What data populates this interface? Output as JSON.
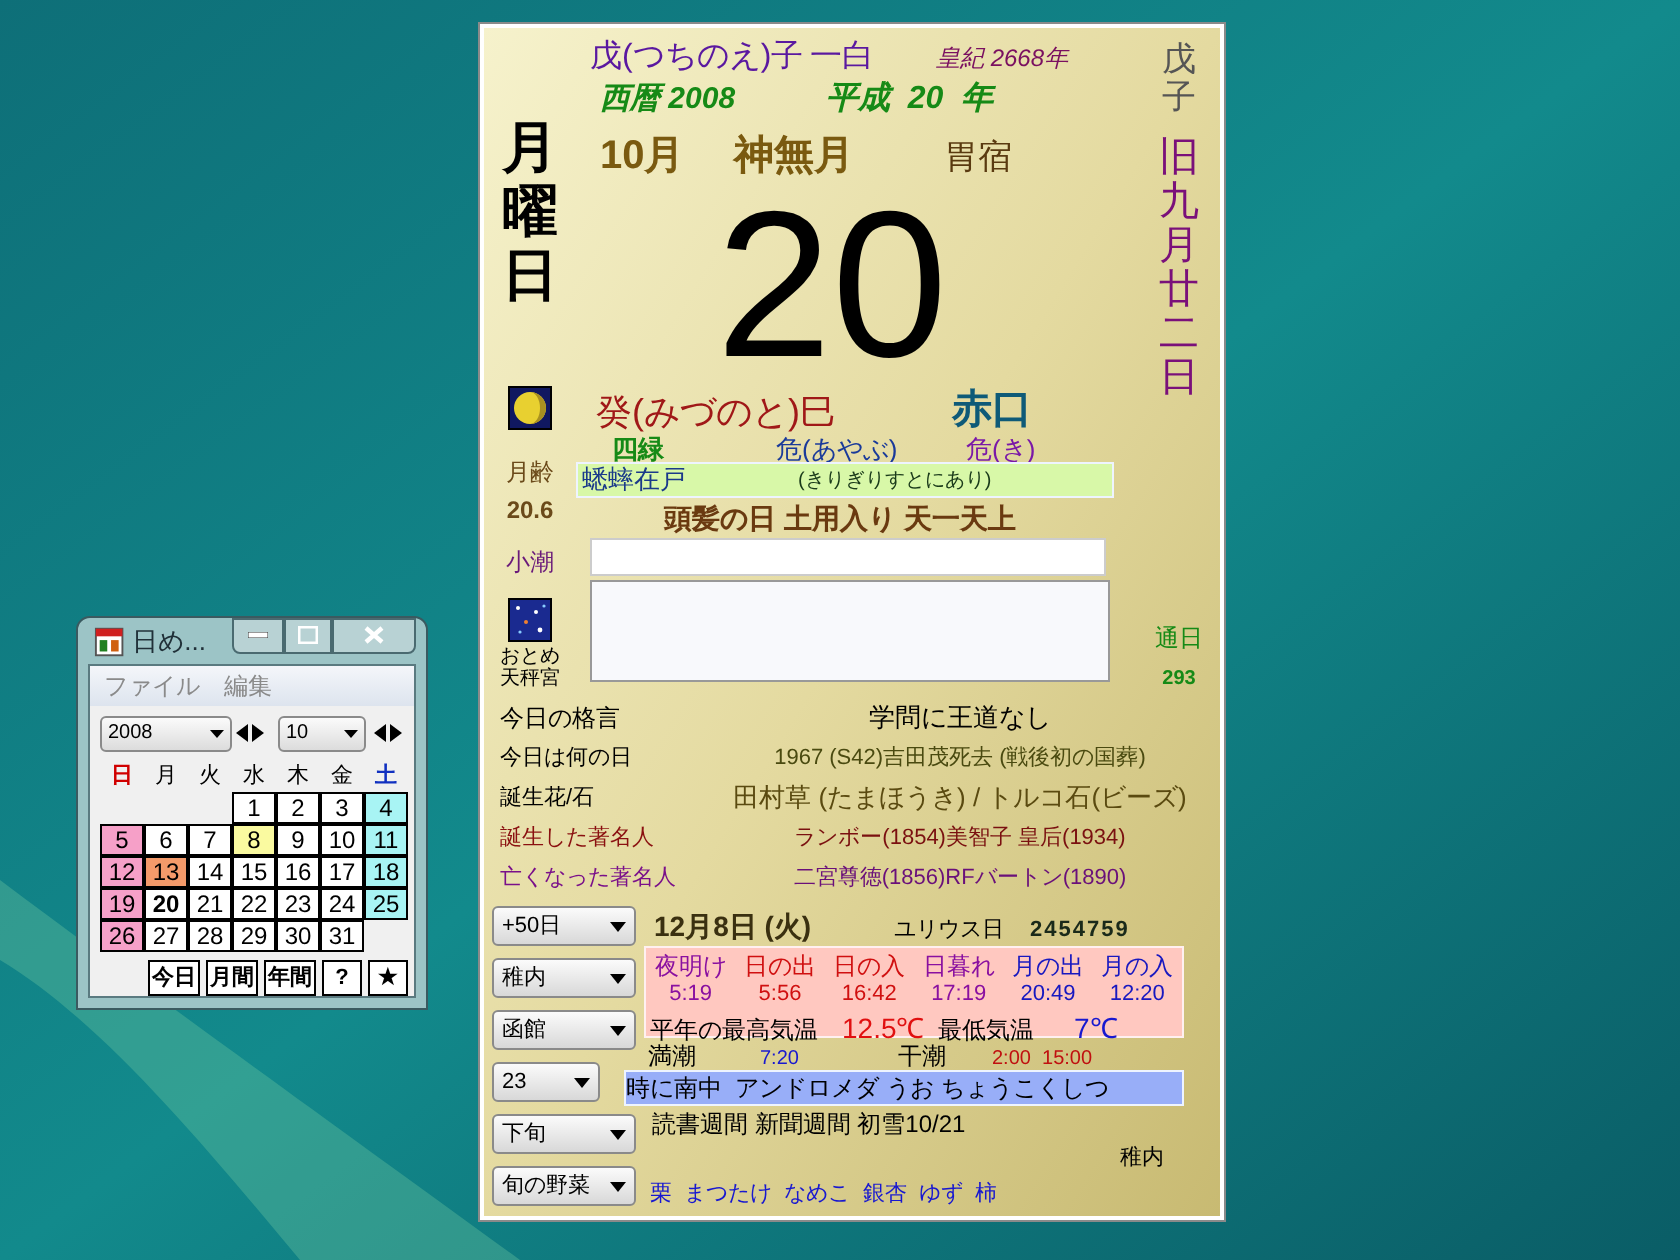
{
  "main_calendar": {
    "year_eto": "戊(つちのえ)子",
    "year_star": "一白",
    "imperial_year": "皇紀 2668年",
    "western_year": "西暦 2008",
    "era_year": "平成  20  年",
    "month": "10月",
    "month_name": "神無月",
    "lunar_mansion": "胃宿",
    "weekday": "月曜日",
    "day": "20",
    "side_eto": "戊子",
    "lunar_date": "旧九月廿二日",
    "moon_age_label": "月齢",
    "moon_age": "20.6",
    "tide": "小潮",
    "zodiac": "おとめ",
    "zodiac_palace": "天秤宮",
    "day_eto": "癸(みづのと)巳",
    "rokuyo": "赤口",
    "day_star": "四緑",
    "choku": "危(あやぶ)",
    "shuku": "危(き)",
    "seasonal_term": "蟋蟀在戸",
    "seasonal_term_reading": "(きりぎりすとにあり)",
    "events": "頭髪の日 土用入り 天一天上",
    "day_count_label": "通日",
    "day_count": "293",
    "info_rows": [
      {
        "kind": "motto",
        "label": "今日の格言",
        "value": "学問に王道なし"
      },
      {
        "kind": "history",
        "label": "今日は何の日",
        "value": "1967 (S42)吉田茂死去 (戦後初の国葬)"
      },
      {
        "kind": "flower",
        "label": "誕生花/石",
        "value": "田村草 (たまほうき) / トルコ石(ビーズ)"
      },
      {
        "kind": "born",
        "label": "誕生した著名人",
        "value": "ランボー(1854)美智子 皇后(1934)"
      },
      {
        "kind": "died",
        "label": "亡くなった著名人",
        "value": "二宮尊徳(1856)RFバートン(1890)"
      }
    ]
  },
  "lower": {
    "selectors": [
      {
        "value": "+50日"
      },
      {
        "value": "稚内"
      },
      {
        "value": "函館"
      },
      {
        "value": "23"
      },
      {
        "value": "下旬"
      },
      {
        "value": "旬の野菜"
      }
    ],
    "future_date": "12月8日 (火)",
    "julian_label": "ユリウス日",
    "julian_day": "2454759",
    "sun_moon": [
      {
        "kind": "twilight",
        "label": "夜明け",
        "time": "5:19"
      },
      {
        "kind": "sun",
        "label": "日の出",
        "time": "5:56"
      },
      {
        "kind": "sun",
        "label": "日の入",
        "time": "16:42"
      },
      {
        "kind": "twilight",
        "label": "日暮れ",
        "time": "17:19"
      },
      {
        "kind": "moon",
        "label": "月の出",
        "time": "20:49"
      },
      {
        "kind": "moon",
        "label": "月の入",
        "time": "12:20"
      }
    ],
    "temp_high_label": "平年の最高気温",
    "temp_high": "12.5℃",
    "temp_low_label": "最低気温",
    "temp_low": "7℃",
    "high_tide_label": "満潮",
    "high_tide": "7:20",
    "low_tide_label": "干潮",
    "low_tide": "2:00  15:00",
    "transit": "時に南中  アンドロメダ うお ちょうこくしつ",
    "notes": "読書週間 新聞週間 初雪10/21",
    "location": "稚内",
    "seasonal_foods": "栗  まつたけ  なめこ  銀杏  ゆず  柿"
  },
  "mini_window": {
    "title": "日め...",
    "menu": [
      "ファイル",
      "編集"
    ],
    "year": "2008",
    "month": "10",
    "weekdays": [
      {
        "label": "日",
        "kind": "sunday"
      },
      {
        "label": "月",
        "kind": "weekday"
      },
      {
        "label": "火",
        "kind": "weekday"
      },
      {
        "label": "水",
        "kind": "weekday"
      },
      {
        "label": "木",
        "kind": "weekday"
      },
      {
        "label": "金",
        "kind": "weekday"
      },
      {
        "label": "土",
        "kind": "saturday"
      }
    ],
    "weeks": [
      [
        {
          "kind": "blank"
        },
        {
          "kind": "blank"
        },
        {
          "kind": "blank"
        },
        {
          "label": "1",
          "color": "#ffffff",
          "selected": false
        },
        {
          "label": "2",
          "color": "#ffffff",
          "selected": false
        },
        {
          "label": "3",
          "color": "#ffffff",
          "selected": false
        },
        {
          "label": "4",
          "color": "#a8f4f4",
          "selected": false
        }
      ],
      [
        {
          "label": "5",
          "color": "#f6a0c8",
          "selected": false
        },
        {
          "label": "6",
          "color": "#ffffff",
          "selected": false
        },
        {
          "label": "7",
          "color": "#ffffff",
          "selected": false
        },
        {
          "label": "8",
          "color": "#fafaa0",
          "selected": false
        },
        {
          "label": "9",
          "color": "#ffffff",
          "selected": false
        },
        {
          "label": "10",
          "color": "#ffffff",
          "selected": false
        },
        {
          "label": "11",
          "color": "#a8f4f4",
          "selected": false
        }
      ],
      [
        {
          "label": "12",
          "color": "#f6a0c8",
          "selected": false
        },
        {
          "label": "13",
          "color": "#f49a6a",
          "selected": false
        },
        {
          "label": "14",
          "color": "#ffffff",
          "selected": false
        },
        {
          "label": "15",
          "color": "#ffffff",
          "selected": false
        },
        {
          "label": "16",
          "color": "#ffffff",
          "selected": false
        },
        {
          "label": "17",
          "color": "#ffffff",
          "selected": false
        },
        {
          "label": "18",
          "color": "#a8f4f4",
          "selected": false
        }
      ],
      [
        {
          "label": "19",
          "color": "#f6a0c8",
          "selected": false
        },
        {
          "label": "20",
          "color": "#ffffff",
          "selected": true
        },
        {
          "label": "21",
          "color": "#ffffff",
          "selected": false
        },
        {
          "label": "22",
          "color": "#ffffff",
          "selected": false
        },
        {
          "label": "23",
          "color": "#ffffff",
          "selected": false
        },
        {
          "label": "24",
          "color": "#ffffff",
          "selected": false
        },
        {
          "label": "25",
          "color": "#a8f4f4",
          "selected": false
        }
      ],
      [
        {
          "label": "26",
          "color": "#f6a0c8",
          "selected": false
        },
        {
          "label": "27",
          "color": "#ffffff",
          "selected": false
        },
        {
          "label": "28",
          "color": "#ffffff",
          "selected": false
        },
        {
          "label": "29",
          "color": "#ffffff",
          "selected": false
        },
        {
          "label": "30",
          "color": "#ffffff",
          "selected": false
        },
        {
          "label": "31",
          "color": "#ffffff",
          "selected": false
        },
        {
          "kind": "blank"
        }
      ]
    ],
    "buttons": [
      "今日",
      "月間",
      "年間",
      "?",
      "★"
    ]
  }
}
